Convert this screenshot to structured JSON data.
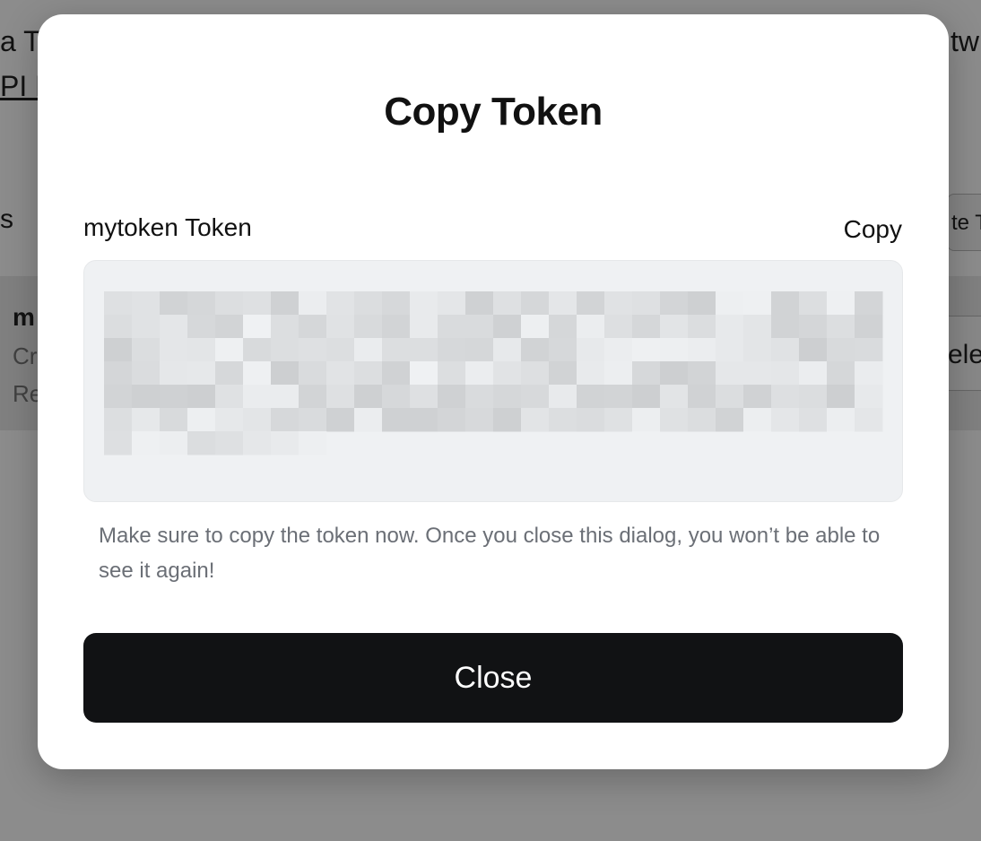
{
  "background": {
    "top_text": "a T",
    "link_text": "PI D",
    "right_text": "tw",
    "section_label": "s",
    "create_button": "te T",
    "card": {
      "name": "m",
      "line1": "Cr",
      "line2": "Re"
    },
    "delete_button": "ele"
  },
  "modal": {
    "title": "Copy Token",
    "token_label": "mytoken Token",
    "copy_label": "Copy",
    "help_text": "Make sure to copy the token now. Once you close this dialog, you won’t be able to see it again!",
    "close_label": "Close"
  },
  "colors": {
    "overlay": "#8a8a8a",
    "modal_bg": "#ffffff",
    "token_box_bg": "#eff1f3",
    "close_button_bg": "#111214",
    "help_text": "#6b6f76"
  }
}
